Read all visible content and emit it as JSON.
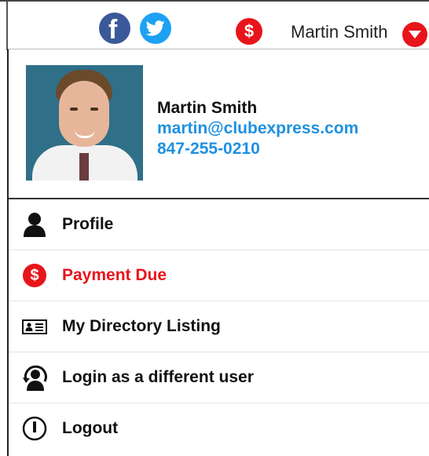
{
  "topbar": {
    "facebook_glyph": "f",
    "payment_glyph": "$",
    "user_name": "Martin Smith",
    "icons": [
      "facebook-icon",
      "twitter-icon",
      "payment-due-icon",
      "chevron-down-icon"
    ]
  },
  "profile": {
    "name": "Martin Smith",
    "email": "martin@clubexpress.com",
    "phone": "847-255-0210"
  },
  "menu": {
    "items": [
      {
        "label": "Profile",
        "icon": "person-icon"
      },
      {
        "label": "Payment Due",
        "icon": "dollar-icon",
        "glyph": "$"
      },
      {
        "label": "My Directory Listing",
        "icon": "id-card-icon"
      },
      {
        "label": "Login as a different user",
        "icon": "switch-user-icon"
      },
      {
        "label": "Logout",
        "icon": "power-icon"
      }
    ]
  },
  "colors": {
    "accent_red": "#e8141b",
    "link_blue": "#1e90e0",
    "facebook_blue": "#3b5998",
    "twitter_blue": "#1da1f2"
  }
}
